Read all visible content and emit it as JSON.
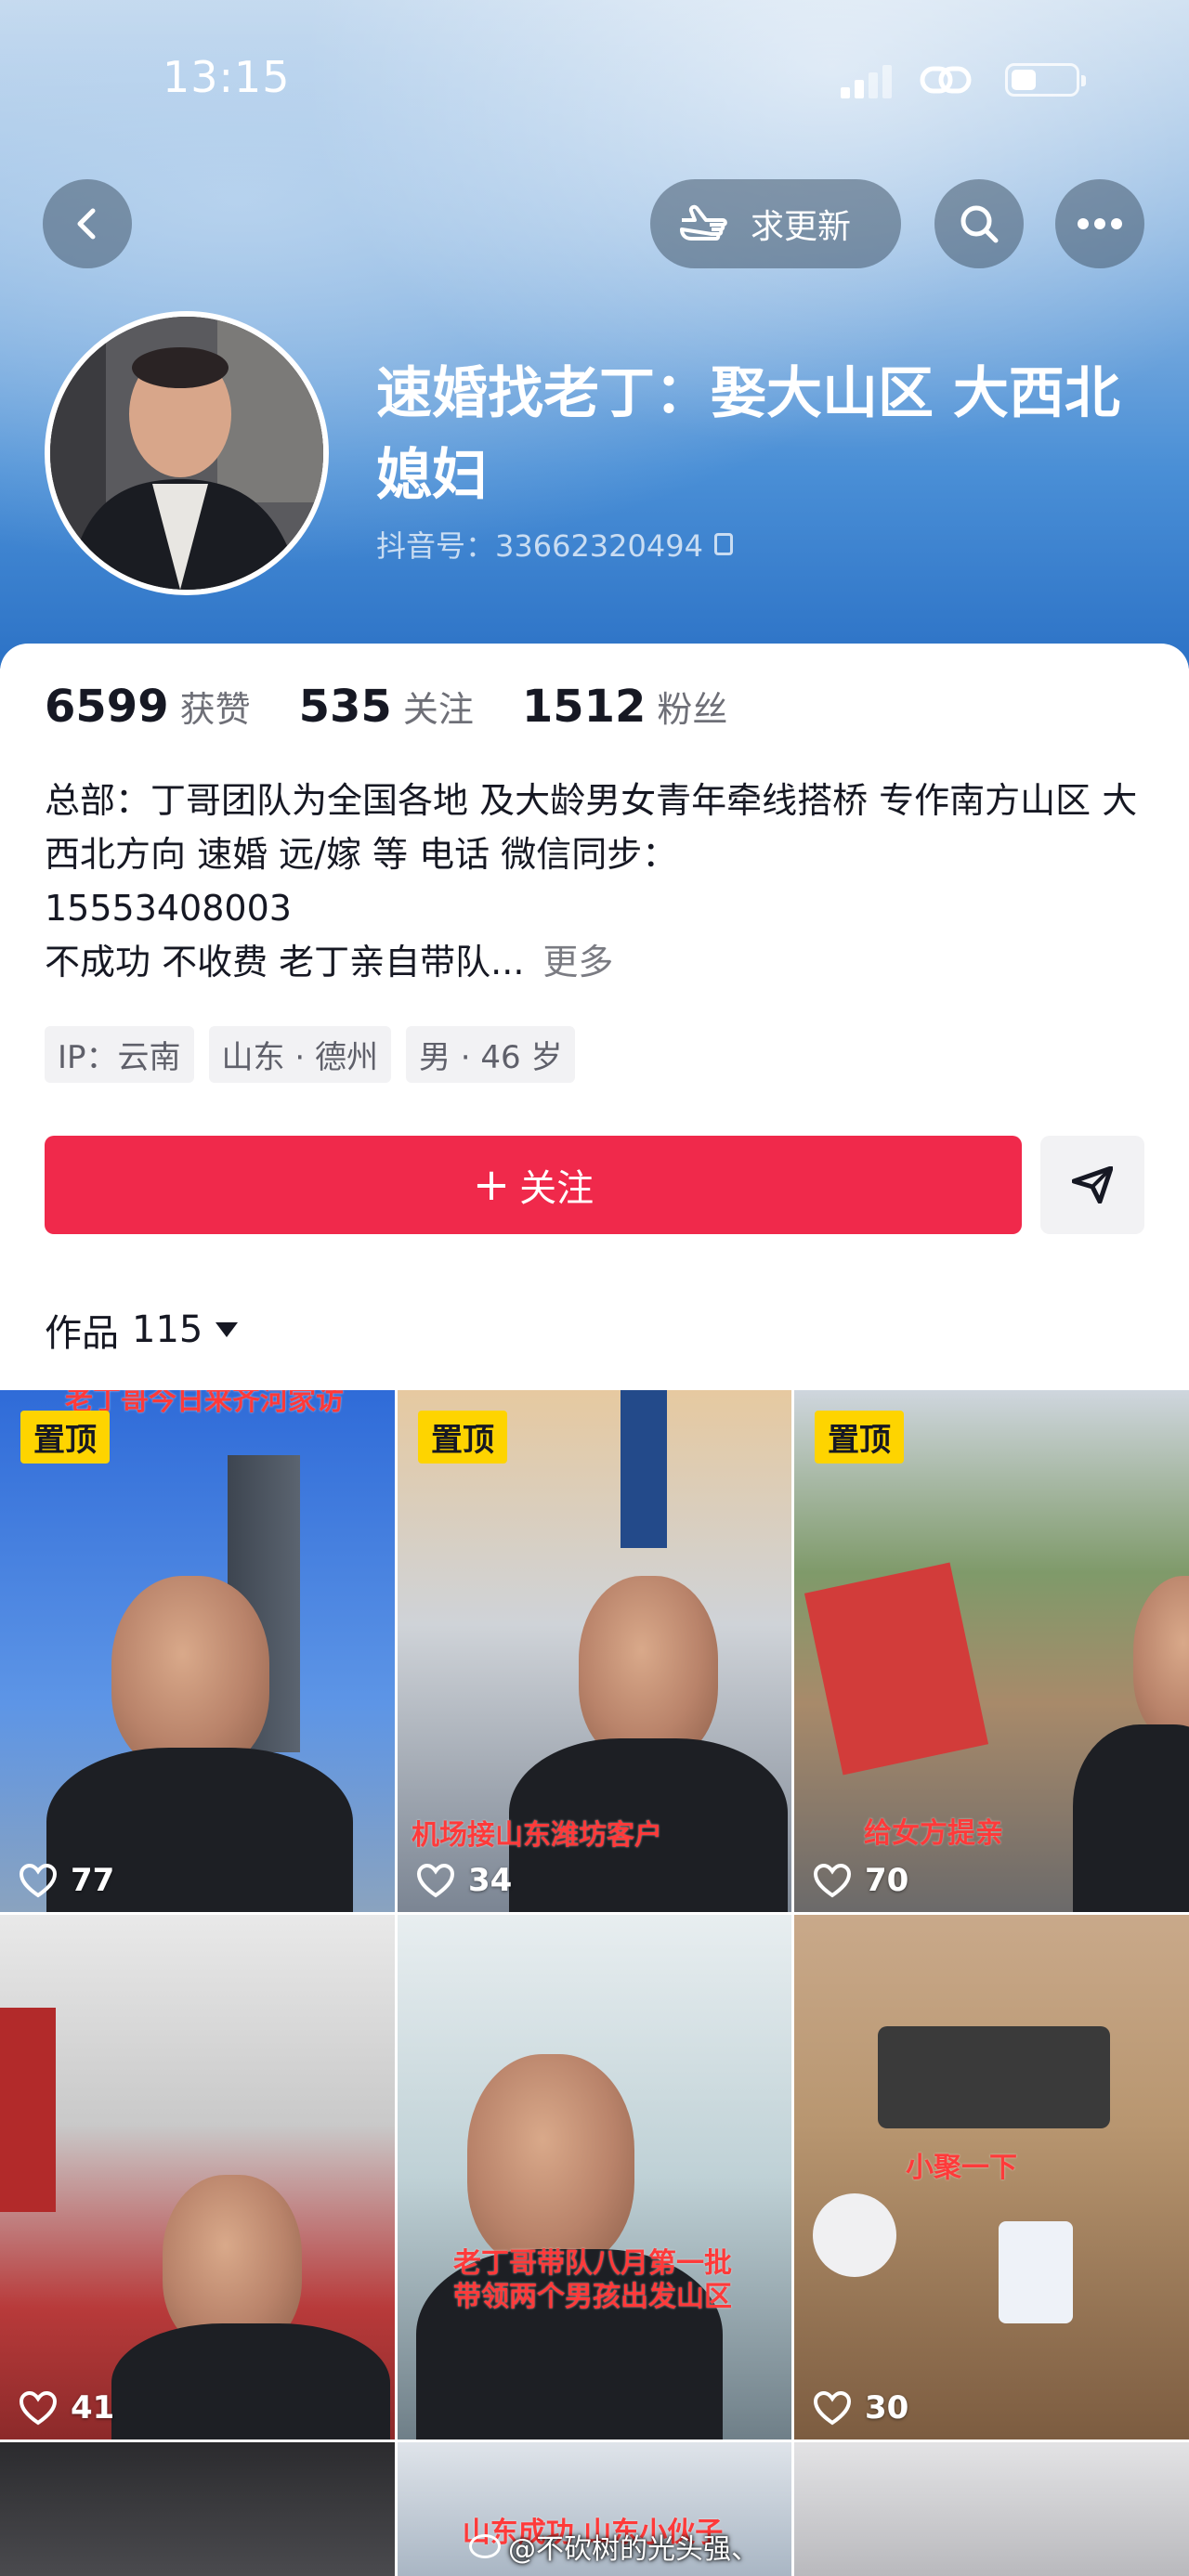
{
  "status_bar": {
    "time": "13:15"
  },
  "header": {
    "request_update_label": "求更新",
    "back_icon": "chevron-left-icon",
    "search_icon": "search-icon",
    "more_icon": "more-icon"
  },
  "profile": {
    "name": "速婚找老丁：娶大山区 大西北媳妇",
    "douyin_id": "抖音号：33662320494"
  },
  "stats": [
    {
      "num": "6599",
      "label": "获赞"
    },
    {
      "num": "535",
      "label": "关注"
    },
    {
      "num": "1512",
      "label": "粉丝"
    }
  ],
  "bio": {
    "line1": "总部：丁哥团队为全国各地 及大龄男女青年牵线搭桥  专作南方山区 大西北方向 速婚  远/嫁 等        电话  微信同步：",
    "phone": "15553408003",
    "line2": " 不成功 不收费 老丁亲自带队...",
    "more": "更多"
  },
  "tags": [
    "IP：云南",
    "山东 · 德州",
    "男 · 46 岁"
  ],
  "follow_label": "关注",
  "works": {
    "label": "作品",
    "count": "115"
  },
  "videos": [
    {
      "pinned": true,
      "pin_label": "置顶",
      "likes": "77",
      "caption_top": "老丁哥今日来齐河家访",
      "caption": ""
    },
    {
      "pinned": true,
      "pin_label": "置顶",
      "likes": "34",
      "caption_top": "",
      "caption": "机场接山东潍坊客户"
    },
    {
      "pinned": true,
      "pin_label": "置顶",
      "likes": "70",
      "caption_top": "",
      "caption": "给女方提亲"
    },
    {
      "pinned": false,
      "pin_label": "",
      "likes": "41",
      "caption_top": "",
      "caption": ""
    },
    {
      "pinned": false,
      "pin_label": "",
      "likes": "",
      "caption_top": "",
      "caption": "老丁哥带队八月第一批\n带领两个男孩出发山区"
    },
    {
      "pinned": false,
      "pin_label": "",
      "likes": "30",
      "caption_top": "",
      "caption": "小聚一下"
    },
    {
      "pinned": false,
      "pin_label": "",
      "likes": "",
      "caption_top": "",
      "caption": ""
    },
    {
      "pinned": false,
      "pin_label": "",
      "likes": "",
      "caption_top": "",
      "caption": "山东成功 山东小伙子"
    },
    {
      "pinned": false,
      "pin_label": "",
      "likes": "",
      "caption_top": "",
      "caption": ""
    }
  ],
  "watermark": "@不砍树的光头强、"
}
